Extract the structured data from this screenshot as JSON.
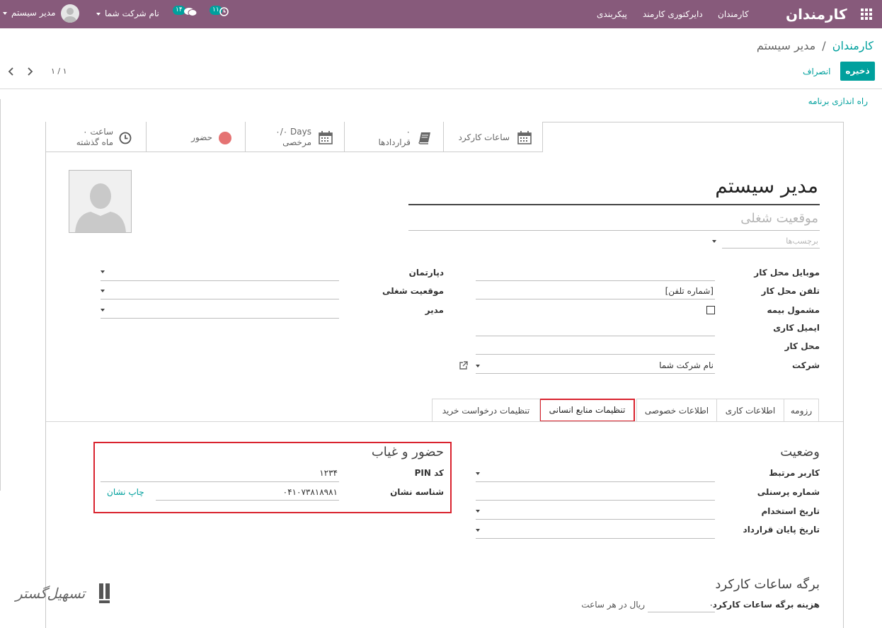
{
  "navbar": {
    "app_name": "کارمندان",
    "menu": [
      "کارمندان",
      "دایرکتوری کارمند",
      "پیکربندی"
    ],
    "activity_count": "۱۱",
    "message_count": "۱۴",
    "company": "نام شرکت شما",
    "user": "مدیر سیستم"
  },
  "breadcrumb": {
    "parent": "کارمندان",
    "separator": "/",
    "current": "مدیر سیستم"
  },
  "actions": {
    "save": "ذخیره",
    "discard": "انصراف"
  },
  "pager": {
    "value": "۱ / ۱"
  },
  "onboarding": "راه اندازی برنامه",
  "smart_buttons": {
    "work_hours": "ساعات کارکرد",
    "contracts_count": "۰",
    "contracts": "قراردادها",
    "leave_value": "۰/۰ Days",
    "leave_label": "مرخصی",
    "presence": "حضور",
    "last_month_value": "۰ ساعت",
    "last_month_label": "ماه گذشته"
  },
  "employee": {
    "name": "مدیر سیستم",
    "job_title_placeholder": "موقعیت شغلی",
    "tags_placeholder": "برچسب‌ها"
  },
  "fields_right": [
    {
      "label": "موبایل محل کار",
      "value": ""
    },
    {
      "label": "تلفن محل کار",
      "value": "[شماره تلفن]"
    },
    {
      "label": "مشمول بیمه",
      "value": ""
    },
    {
      "label": "ایمیل کاری",
      "value": ""
    },
    {
      "label": "محل کار",
      "value": ""
    },
    {
      "label": "شرکت",
      "value": "نام شرکت شما"
    }
  ],
  "fields_left": [
    {
      "label": "دپارتمان",
      "value": ""
    },
    {
      "label": "موقعیت شغلی",
      "value": ""
    },
    {
      "label": "مدیر",
      "value": ""
    }
  ],
  "tabs": [
    "رزومه",
    "اطلاعات کاری",
    "اطلاعات خصوصی",
    "تنظیمات منابع انسانی",
    "تنظیمات درخواست خرید"
  ],
  "status_section": {
    "title": "وضعیت",
    "fields": [
      {
        "label": "کاربر مرتبط",
        "value": ""
      },
      {
        "label": "شماره پرسنلی",
        "value": ""
      },
      {
        "label": "تاریخ استخدام",
        "value": ""
      },
      {
        "label": "تاریخ پایان قرارداد",
        "value": ""
      }
    ]
  },
  "attendance_section": {
    "title": "حضور و غیاب",
    "pin_label": "کد PIN",
    "pin_value": "۱۲۳۴",
    "badge_label": "شناسه نشان",
    "badge_value": "۰۴۱۰۷۳۸۱۸۹۸۱",
    "print_badge": "چاپ نشان"
  },
  "timesheet_section": {
    "title": "برگه ساعات کارکرد",
    "cost_label": "هزینه برگه ساعات کارکرد",
    "cost_value": "۰",
    "cost_unit": "ریال در هر ساعت"
  },
  "watermark": "تسهیل‌گستر",
  "colors": {
    "brand": "#875A7B",
    "accent": "#00A09D",
    "highlight": "#d9232e",
    "presence_dot": "#e57373"
  }
}
